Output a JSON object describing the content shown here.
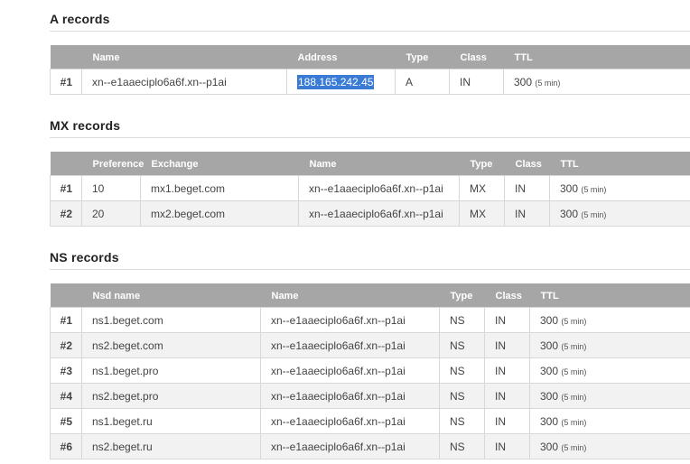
{
  "a_section": {
    "title": "A records",
    "headers": [
      "",
      "Name",
      "Address",
      "Type",
      "Class",
      "TTL"
    ],
    "rows": [
      {
        "num": "#1",
        "name": "xn--e1aaeciplo6a6f.xn--p1ai",
        "address": "188.165.242.45",
        "type": "A",
        "class": "IN",
        "ttl": "300",
        "ttl_note": "(5 min)"
      }
    ]
  },
  "mx_section": {
    "title": "MX records",
    "headers": [
      "",
      "Preference",
      "Exchange",
      "Name",
      "Type",
      "Class",
      "TTL"
    ],
    "rows": [
      {
        "num": "#1",
        "preference": "10",
        "exchange": "mx1.beget.com",
        "name": "xn--e1aaeciplo6a6f.xn--p1ai",
        "type": "MX",
        "class": "IN",
        "ttl": "300",
        "ttl_note": "(5 min)"
      },
      {
        "num": "#2",
        "preference": "20",
        "exchange": "mx2.beget.com",
        "name": "xn--e1aaeciplo6a6f.xn--p1ai",
        "type": "MX",
        "class": "IN",
        "ttl": "300",
        "ttl_note": "(5 min)"
      }
    ]
  },
  "ns_section": {
    "title": "NS records",
    "headers": [
      "",
      "Nsd name",
      "Name",
      "Type",
      "Class",
      "TTL"
    ],
    "rows": [
      {
        "num": "#1",
        "nsd": "ns1.beget.com",
        "name": "xn--e1aaeciplo6a6f.xn--p1ai",
        "type": "NS",
        "class": "IN",
        "ttl": "300",
        "ttl_note": "(5 min)"
      },
      {
        "num": "#2",
        "nsd": "ns2.beget.com",
        "name": "xn--e1aaeciplo6a6f.xn--p1ai",
        "type": "NS",
        "class": "IN",
        "ttl": "300",
        "ttl_note": "(5 min)"
      },
      {
        "num": "#3",
        "nsd": "ns1.beget.pro",
        "name": "xn--e1aaeciplo6a6f.xn--p1ai",
        "type": "NS",
        "class": "IN",
        "ttl": "300",
        "ttl_note": "(5 min)"
      },
      {
        "num": "#4",
        "nsd": "ns2.beget.pro",
        "name": "xn--e1aaeciplo6a6f.xn--p1ai",
        "type": "NS",
        "class": "IN",
        "ttl": "300",
        "ttl_note": "(5 min)"
      },
      {
        "num": "#5",
        "nsd": "ns1.beget.ru",
        "name": "xn--e1aaeciplo6a6f.xn--p1ai",
        "type": "NS",
        "class": "IN",
        "ttl": "300",
        "ttl_note": "(5 min)"
      },
      {
        "num": "#6",
        "nsd": "ns2.beget.ru",
        "name": "xn--e1aaeciplo6a6f.xn--p1ai",
        "type": "NS",
        "class": "IN",
        "ttl": "300",
        "ttl_note": "(5 min)"
      }
    ]
  }
}
